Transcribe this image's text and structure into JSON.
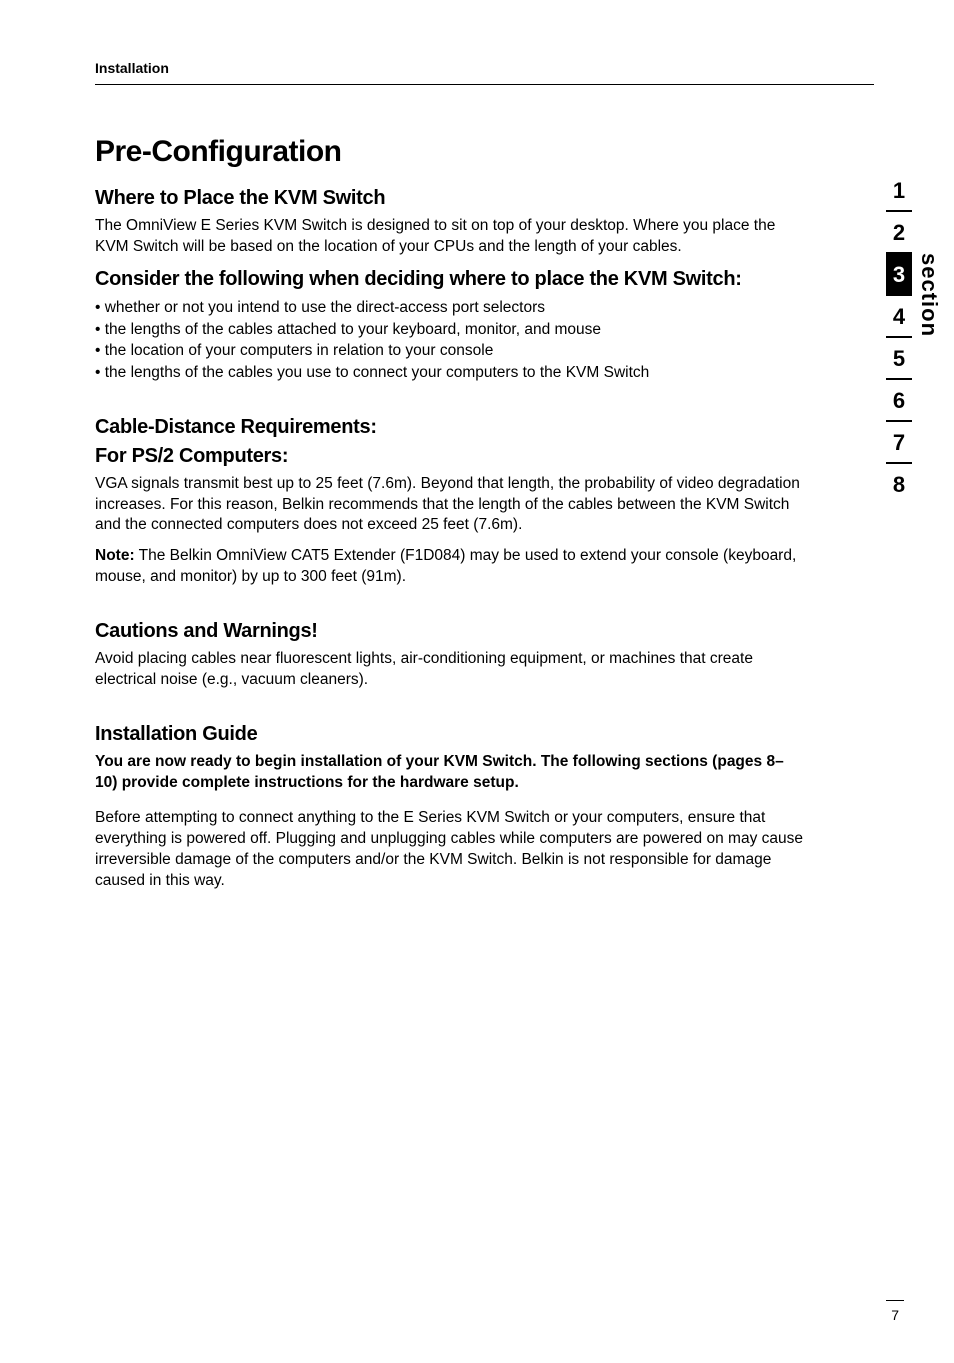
{
  "header": {
    "section_title": "Installation"
  },
  "title": "Pre-Configuration",
  "where_to_place": {
    "heading": "Where to Place the KVM Switch",
    "body": "The OmniView E Series KVM Switch is designed to sit on top of your desktop. Where you place the KVM Switch will be based on the location of your CPUs and the length of your cables."
  },
  "consider": {
    "heading": "Consider the following when deciding where to place the KVM Switch:",
    "bullets": [
      "whether or not you intend to use the direct-access port selectors",
      "the lengths of the cables attached to your keyboard, monitor, and mouse",
      "the location of your computers in relation to your console",
      "the lengths of the cables you use to connect your computers to the KVM Switch"
    ]
  },
  "cable_distance": {
    "heading": "Cable-Distance Requirements:"
  },
  "ps2": {
    "heading": "For PS/2 Computers:",
    "body": "VGA signals transmit best up to 25 feet (7.6m). Beyond that length, the probability of video degradation increases. For this reason, Belkin recommends that the length of the cables between the KVM Switch and the connected computers does not exceed 25 feet (7.6m).",
    "note_label": "Note:",
    "note_body": " The Belkin OmniView CAT5 Extender (F1D084) may be used to extend your console (keyboard, mouse, and monitor) by up to 300 feet (91m)."
  },
  "cautions": {
    "heading": "Cautions and Warnings!",
    "body": "Avoid placing cables near fluorescent lights, air-conditioning equipment, or machines that create electrical noise (e.g., vacuum cleaners)."
  },
  "install_guide": {
    "heading": "Installation Guide",
    "bold_intro": "You are now ready to begin installation of your KVM Switch. The following sections (pages 8–10) provide complete instructions for the hardware setup.",
    "body": "Before attempting to connect anything to the E Series KVM Switch or your computers, ensure that everything is powered off. Plugging and unplugging cables while computers are powered on may cause irreversible damage of the computers and/or the KVM Switch. Belkin is not responsible for damage caused in this way."
  },
  "side_nav": {
    "label": "section",
    "items": [
      "1",
      "2",
      "3",
      "4",
      "5",
      "6",
      "7",
      "8"
    ],
    "active_index": 2
  },
  "page_number": "7"
}
